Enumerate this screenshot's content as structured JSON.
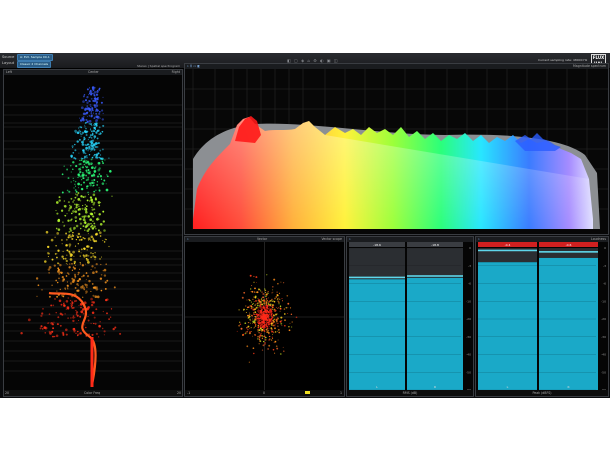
{
  "topbar": {
    "source_label": "Source",
    "source_value": "A: Ext. Sample 00-1",
    "layout_label": "Layout",
    "layout_value": "Classic 2 Channels",
    "sample_rate_text": "Current sampling rate: 48000 Hz",
    "logo_line1": "FLUX",
    "logo_line2": "HAL",
    "center_glyphs": "◧ ▢ ◈ ⌂ ⚙ ◐ ▣ ◫"
  },
  "colors": {
    "accent": "#2a5c86",
    "meter_cyan": "#1aa9c8",
    "meter_peak": "#d02020",
    "spectrum_gray": "#8c8f93"
  },
  "history_panel": {
    "left_label": "Left",
    "center_label": "Center",
    "right_label": "Right",
    "header_right": "Stereo | Spatial spectrogram",
    "footer_label": "Color Freq",
    "bottom_tick_left": "20",
    "bottom_tick_right": "20"
  },
  "spectrum_panel": {
    "header_right": "Magnitude spectrum",
    "toolbar": "⌁ ⚲ ▭ ◧"
  },
  "vector_panel": {
    "title": "Vector",
    "header_right": "Vector scope",
    "footer_left": "-1",
    "footer_center": "0",
    "footer_right": "1"
  },
  "meter_panel_1": {
    "ch_left_value": "-18.6",
    "ch_right_value": "-18.8",
    "ch_left_label": "L",
    "ch_right_label": "R",
    "footer_label": "RMS (dB)",
    "left_level": 0.78,
    "right_level": 0.79,
    "left_peak": 0.79,
    "right_peak": 0.8,
    "scale": [
      "0",
      "-3",
      "-6",
      "-10",
      "-20",
      "-30",
      "-40",
      "-50",
      "-60"
    ]
  },
  "meter_panel_2": {
    "ch_left_value": "-0.4",
    "ch_right_value": "-0.6",
    "ch_left_label": "L",
    "ch_right_label": "R",
    "footer_label": "Peak (dBFS)",
    "left_level": 0.9,
    "right_level": 0.93,
    "left_peak": 0.98,
    "right_peak": 0.97,
    "header_right": "Loudness",
    "scale": [
      "0",
      "-3",
      "-6",
      "-10",
      "-20",
      "-30",
      "-40",
      "-50",
      "-60"
    ]
  }
}
